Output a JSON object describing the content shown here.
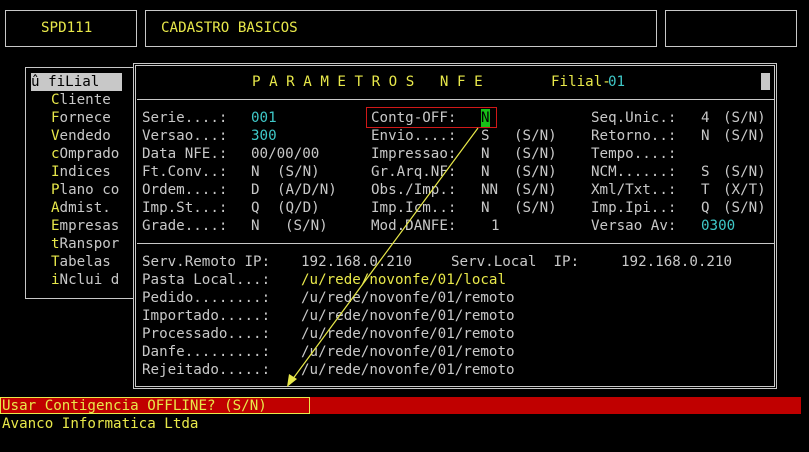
{
  "header": {
    "program_code": "SPD111",
    "module_title": "CADASTRO BASICOS",
    "right_panel": ""
  },
  "menu": {
    "items": [
      {
        "hotkey": "û ",
        "rest": "fiLial",
        "selected": true
      },
      {
        "hotkey": "C",
        "rest": "liente"
      },
      {
        "hotkey": "F",
        "rest": "ornece"
      },
      {
        "hotkey": "V",
        "rest": "endedo"
      },
      {
        "hotkey": "c",
        "rest": "Omprado"
      },
      {
        "hotkey": "I",
        "rest": "ndices"
      },
      {
        "hotkey": "P",
        "rest": "lano co"
      },
      {
        "hotkey": "A",
        "rest": "dmist."
      },
      {
        "hotkey": "E",
        "rest": "mpresas"
      },
      {
        "hotkey": "t",
        "rest": "Ranspor"
      },
      {
        "hotkey": "T",
        "rest": "abelas"
      },
      {
        "hotkey": "i",
        "rest": "Nclui d"
      }
    ]
  },
  "dialog": {
    "title": "P A R A M E T R O S   N F E",
    "filial_label": "Filial-",
    "filial_value": "01",
    "col1": [
      {
        "label": "Serie....:",
        "value": "001",
        "hint": ""
      },
      {
        "label": "Versao...:",
        "value": "300",
        "hint": ""
      },
      {
        "label": "Data NFE.:",
        "value": "00/00/00",
        "hint": ""
      },
      {
        "label": "Ft.Conv..:",
        "value": "N",
        "hint": "(S/N)"
      },
      {
        "label": "Ordem....:",
        "value": "D",
        "hint": "(A/D/N)"
      },
      {
        "label": "Imp.St...:",
        "value": "Q",
        "hint": "(Q/D)"
      },
      {
        "label": "Grade....:",
        "value": "N",
        "hint": "(S/N)"
      }
    ],
    "col2": [
      {
        "label": "Contg-OFF:",
        "value": "N",
        "hint": ""
      },
      {
        "label": "Envio....:",
        "value": "S",
        "hint": "(S/N)"
      },
      {
        "label": "Impressao:",
        "value": "N",
        "hint": "(S/N)"
      },
      {
        "label": "Gr.Arq.NF:",
        "value": "N",
        "hint": "(S/N)"
      },
      {
        "label": "Obs./Imp.:",
        "value": "NN",
        "hint": "(S/N)"
      },
      {
        "label": "Imp.Icm..:",
        "value": "N",
        "hint": "(S/N)"
      },
      {
        "label": "Mod.DANFE:",
        "value": "1",
        "hint": ""
      }
    ],
    "col3": [
      {
        "label": "Seq.Unic.:",
        "value": "4",
        "hint": "(S/N)"
      },
      {
        "label": "Retorno..:",
        "value": "N",
        "hint": "(S/N)"
      },
      {
        "label": "Tempo....:",
        "value": "",
        "hint": ""
      },
      {
        "label": "NCM......:",
        "value": "S",
        "hint": "(S/N)"
      },
      {
        "label": "Xml/Txt..:",
        "value": "T",
        "hint": "(X/T)"
      },
      {
        "label": "Imp.Ipi..:",
        "value": "Q",
        "hint": "(S/N)"
      },
      {
        "label": "Versao Av:",
        "value": "0300",
        "hint": ""
      }
    ],
    "serv_remoto_label": "Serv.Remoto IP:",
    "serv_remoto_value": "192.168.0.210",
    "serv_local_label": "Serv.Local  IP:",
    "serv_local_value": "192.168.0.210",
    "paths": [
      {
        "label": "Pasta Local...:",
        "value": "/u/rede/novonfe/01/local"
      },
      {
        "label": "Pedido........:",
        "value": "/u/rede/novonfe/01/remoto"
      },
      {
        "label": "Importado.....:",
        "value": "/u/rede/novonfe/01/remoto"
      },
      {
        "label": "Processado....:",
        "value": "/u/rede/novonfe/01/remoto"
      },
      {
        "label": "Danfe.........:",
        "value": "/u/rede/novonfe/01/remoto"
      },
      {
        "label": "Rejeitado.....:",
        "value": "/u/rede/novonfe/01/remoto"
      }
    ]
  },
  "status": {
    "prompt": "Usar Contigencia OFFLINE? (S/N)",
    "company": "Avanco Informatica Ltda"
  },
  "colors": {
    "accent_yellow": "#e8e84a",
    "cyan": "#3fc8c8",
    "status_red": "#c00000",
    "cursor_green": "#18c018"
  }
}
